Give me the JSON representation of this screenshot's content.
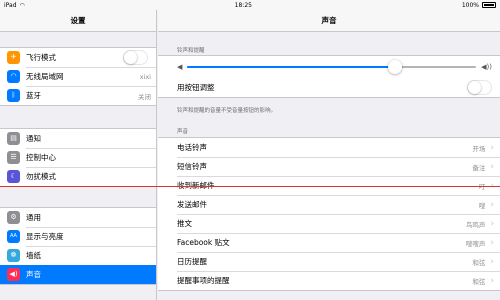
{
  "status": {
    "device": "iPad",
    "time": "18:25",
    "battery": "100%"
  },
  "master": {
    "title": "设置",
    "groups": [
      [
        {
          "label": "飞行模式",
          "icon": "airplane-icon",
          "color": "#ff9500",
          "glyph": "✈",
          "toggle": true
        },
        {
          "label": "无线局域网",
          "icon": "wifi-icon",
          "color": "#007aff",
          "glyph": "◠",
          "value": "xixi"
        },
        {
          "label": "蓝牙",
          "icon": "bluetooth-icon",
          "color": "#007aff",
          "glyph": "ᛒ",
          "value": "关闭"
        }
      ],
      [
        {
          "label": "通知",
          "icon": "notifications-icon",
          "color": "#8e8e93",
          "glyph": "▤"
        },
        {
          "label": "控制中心",
          "icon": "control-center-icon",
          "color": "#8e8e93",
          "glyph": "☰"
        },
        {
          "label": "勿扰模式",
          "icon": "do-not-disturb-icon",
          "color": "#5856d6",
          "glyph": "☾"
        }
      ],
      [
        {
          "label": "通用",
          "icon": "gear-icon",
          "color": "#8e8e93",
          "glyph": "⚙"
        },
        {
          "label": "显示与亮度",
          "icon": "display-icon",
          "color": "#007aff",
          "glyph": "AA"
        },
        {
          "label": "墙纸",
          "icon": "wallpaper-icon",
          "color": "#34aadc",
          "glyph": "❁"
        },
        {
          "label": "声音",
          "icon": "sound-icon",
          "color": "#ff2d55",
          "glyph": "◀)",
          "selected": true
        }
      ]
    ]
  },
  "detail": {
    "title": "声音",
    "ringer_header": "铃声和提醒",
    "volume_level": 0.72,
    "button_adjust_label": "用按钮调整",
    "ringer_note": "铃声和提醒的音量不受音量按钮的影响。",
    "sounds_header": "声音",
    "sounds": [
      {
        "label": "电话铃声",
        "value": "开场"
      },
      {
        "label": "短信铃声",
        "value": "备注"
      },
      {
        "label": "收到新邮件",
        "value": "叮"
      },
      {
        "label": "发送邮件",
        "value": "嗖"
      },
      {
        "label": "推文",
        "value": "鸟鸣声"
      },
      {
        "label": "Facebook 贴文",
        "value": "嗖嗖声"
      },
      {
        "label": "日历提醒",
        "value": "和弦"
      },
      {
        "label": "提醒事项的提醒",
        "value": "和弦"
      }
    ]
  }
}
